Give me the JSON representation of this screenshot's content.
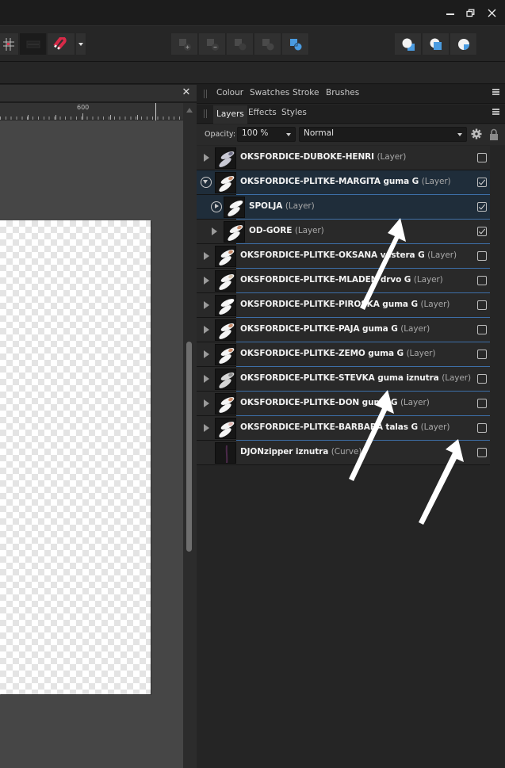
{
  "window": {
    "controls": {
      "minimize_icon": "minimize-icon",
      "restore_icon": "restore-icon",
      "close_icon": "close-icon"
    }
  },
  "toolbar": {
    "left_tools": [
      {
        "name": "snapping-grid-icon"
      },
      {
        "name": "alignment-icon"
      },
      {
        "name": "magnet-icon"
      },
      {
        "name": "snapping-options-dropdown"
      }
    ],
    "boolean_ops": [
      {
        "name": "add-icon"
      },
      {
        "name": "subtract-icon"
      },
      {
        "name": "intersect-icon"
      },
      {
        "name": "xor-icon"
      },
      {
        "name": "divide-icon"
      }
    ],
    "arrange": [
      {
        "name": "send-to-back-icon"
      },
      {
        "name": "bring-forward-icon"
      },
      {
        "name": "insert-inside-icon"
      }
    ]
  },
  "document": {
    "close_label": "✕",
    "ruler": {
      "major_label": "600"
    }
  },
  "panels": {
    "top_tabs": [
      {
        "label": "Colour"
      },
      {
        "label": "Swatches"
      },
      {
        "label": "Stroke"
      },
      {
        "label": "Brushes"
      }
    ],
    "layer_tabs": [
      {
        "label": "Layers",
        "active": true
      },
      {
        "label": "Effects"
      },
      {
        "label": "Styles"
      }
    ],
    "opacity_label": "Opacity:",
    "opacity_value": "100 %",
    "blend_mode": "Normal",
    "accent_color": "#3d6fa8",
    "selected_row_color": "#1f2d3a"
  },
  "layers": [
    {
      "name": "OKSFORDICE-DUBOKE-HENRI",
      "type": "(Layer)",
      "checked": false,
      "level": 0,
      "expander": "arrow",
      "selected": false
    },
    {
      "name": "OKSFORDICE-PLITKE-MARGITA guma G",
      "type": "(Layer)",
      "checked": true,
      "level": 0,
      "expander": "circle-down",
      "selected": true
    },
    {
      "name": "SPOLJA",
      "type": "(Layer)",
      "checked": true,
      "level": 1,
      "expander": "circle-right",
      "selected": true
    },
    {
      "name": "OD-GORE",
      "type": "(Layer)",
      "checked": true,
      "level": 1,
      "expander": "arrow",
      "selected": false
    },
    {
      "name": "OKSFORDICE-PLITKE-OKSANA vestera G",
      "type": "(Layer)",
      "checked": false,
      "level": 0,
      "expander": "arrow",
      "selected": false
    },
    {
      "name": "OKSFORDICE-PLITKE-MLADEN drvo G",
      "type": "(Layer)",
      "checked": false,
      "level": 0,
      "expander": "arrow",
      "selected": false
    },
    {
      "name": "OKSFORDICE-PLITKE-PIROSKA guma G",
      "type": "(Layer)",
      "checked": false,
      "level": 0,
      "expander": "arrow",
      "selected": false
    },
    {
      "name": "OKSFORDICE-PLITKE-PAJA guma G",
      "type": "(Layer)",
      "checked": false,
      "level": 0,
      "expander": "arrow",
      "selected": false
    },
    {
      "name": "OKSFORDICE-PLITKE-ZEMO guma G",
      "type": "(Layer)",
      "checked": false,
      "level": 0,
      "expander": "arrow",
      "selected": false
    },
    {
      "name": "OKSFORDICE-PLITKE-STEVKA guma iznutra",
      "type": "(Layer)",
      "checked": false,
      "level": 0,
      "expander": "arrow",
      "selected": false
    },
    {
      "name": "OKSFORDICE-PLITKE-DON guma G",
      "type": "(Layer)",
      "checked": false,
      "level": 0,
      "expander": "arrow",
      "selected": false
    },
    {
      "name": "OKSFORDICE-PLITKE-BARBARA talas G",
      "type": "(Layer)",
      "checked": false,
      "level": 0,
      "expander": "arrow",
      "selected": false
    },
    {
      "name": "DJONzipper iznutra",
      "type": "(Curve)",
      "checked": false,
      "level": 0,
      "expander": "none",
      "selected": false
    }
  ]
}
